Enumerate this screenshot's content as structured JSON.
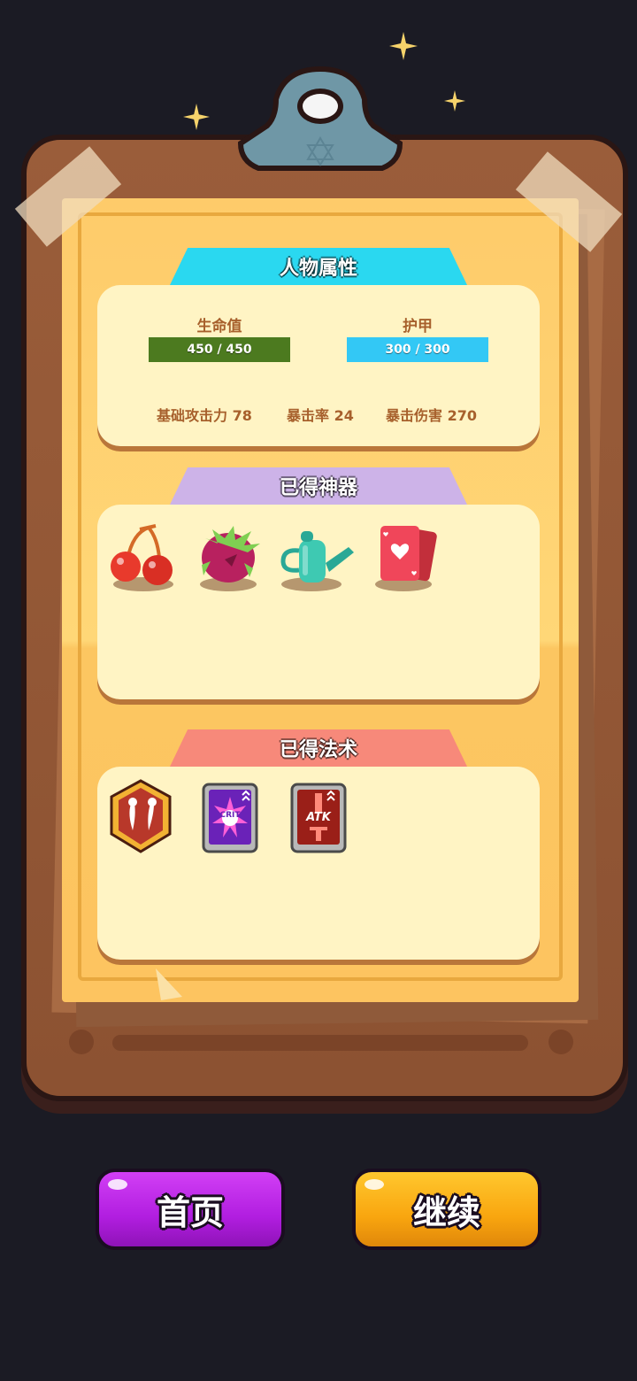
{
  "sections": {
    "attributes": {
      "title": "人物属性",
      "color": "#2ad8f0",
      "hp": {
        "label": "生命值",
        "value": "450 / 450",
        "fraction": 1.0,
        "color": "#4c7a1f"
      },
      "armor": {
        "label": "护甲",
        "value": "300 / 300",
        "fraction": 1.0,
        "color": "#33c8f5"
      },
      "stats": [
        {
          "label": "基础攻击力 78"
        },
        {
          "label": "暴击率 24"
        },
        {
          "label": "暴击伤害 270"
        }
      ]
    },
    "artifacts": {
      "title": "已得神器",
      "color": "#cdb3e8",
      "items": [
        {
          "icon": "cherry-icon"
        },
        {
          "icon": "dragon-fruit-icon"
        },
        {
          "icon": "watering-can-icon"
        },
        {
          "icon": "heart-cards-icon"
        }
      ]
    },
    "spells": {
      "title": "已得法术",
      "color": "#f7897a",
      "items": [
        {
          "icon": "twin-fang-badge-icon"
        },
        {
          "icon": "crit-up-icon",
          "text": "CRIT"
        },
        {
          "icon": "atk-up-icon",
          "text": "ATK"
        }
      ]
    }
  },
  "buttons": {
    "home": {
      "label": "首页",
      "color": "#b11ee0"
    },
    "continue": {
      "label": "继续",
      "color": "#f9a60f"
    }
  }
}
